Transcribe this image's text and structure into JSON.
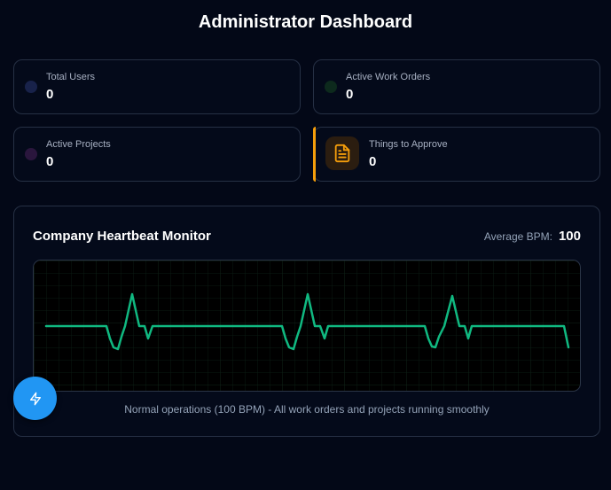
{
  "header": {
    "title": "Administrator Dashboard"
  },
  "stats": [
    {
      "label": "Total Users",
      "value": "0",
      "dot_color": "#18224a"
    },
    {
      "label": "Active Work Orders",
      "value": "0",
      "dot_color": "#0d2a1d"
    },
    {
      "label": "Active Projects",
      "value": "0",
      "dot_color": "#2a163d"
    },
    {
      "label": "Things to Approve",
      "value": "0",
      "accent_color": "#f59e0b",
      "icon": "document-icon"
    }
  ],
  "monitor": {
    "title": "Company Heartbeat Monitor",
    "bpm_label": "Average BPM:",
    "bpm_value": "100",
    "status_text": "Normal operations (100 BPM) - All work orders and projects running smoothly",
    "line_color": "#10b981"
  },
  "fab": {
    "icon": "bolt-icon",
    "color": "#2196f3"
  }
}
